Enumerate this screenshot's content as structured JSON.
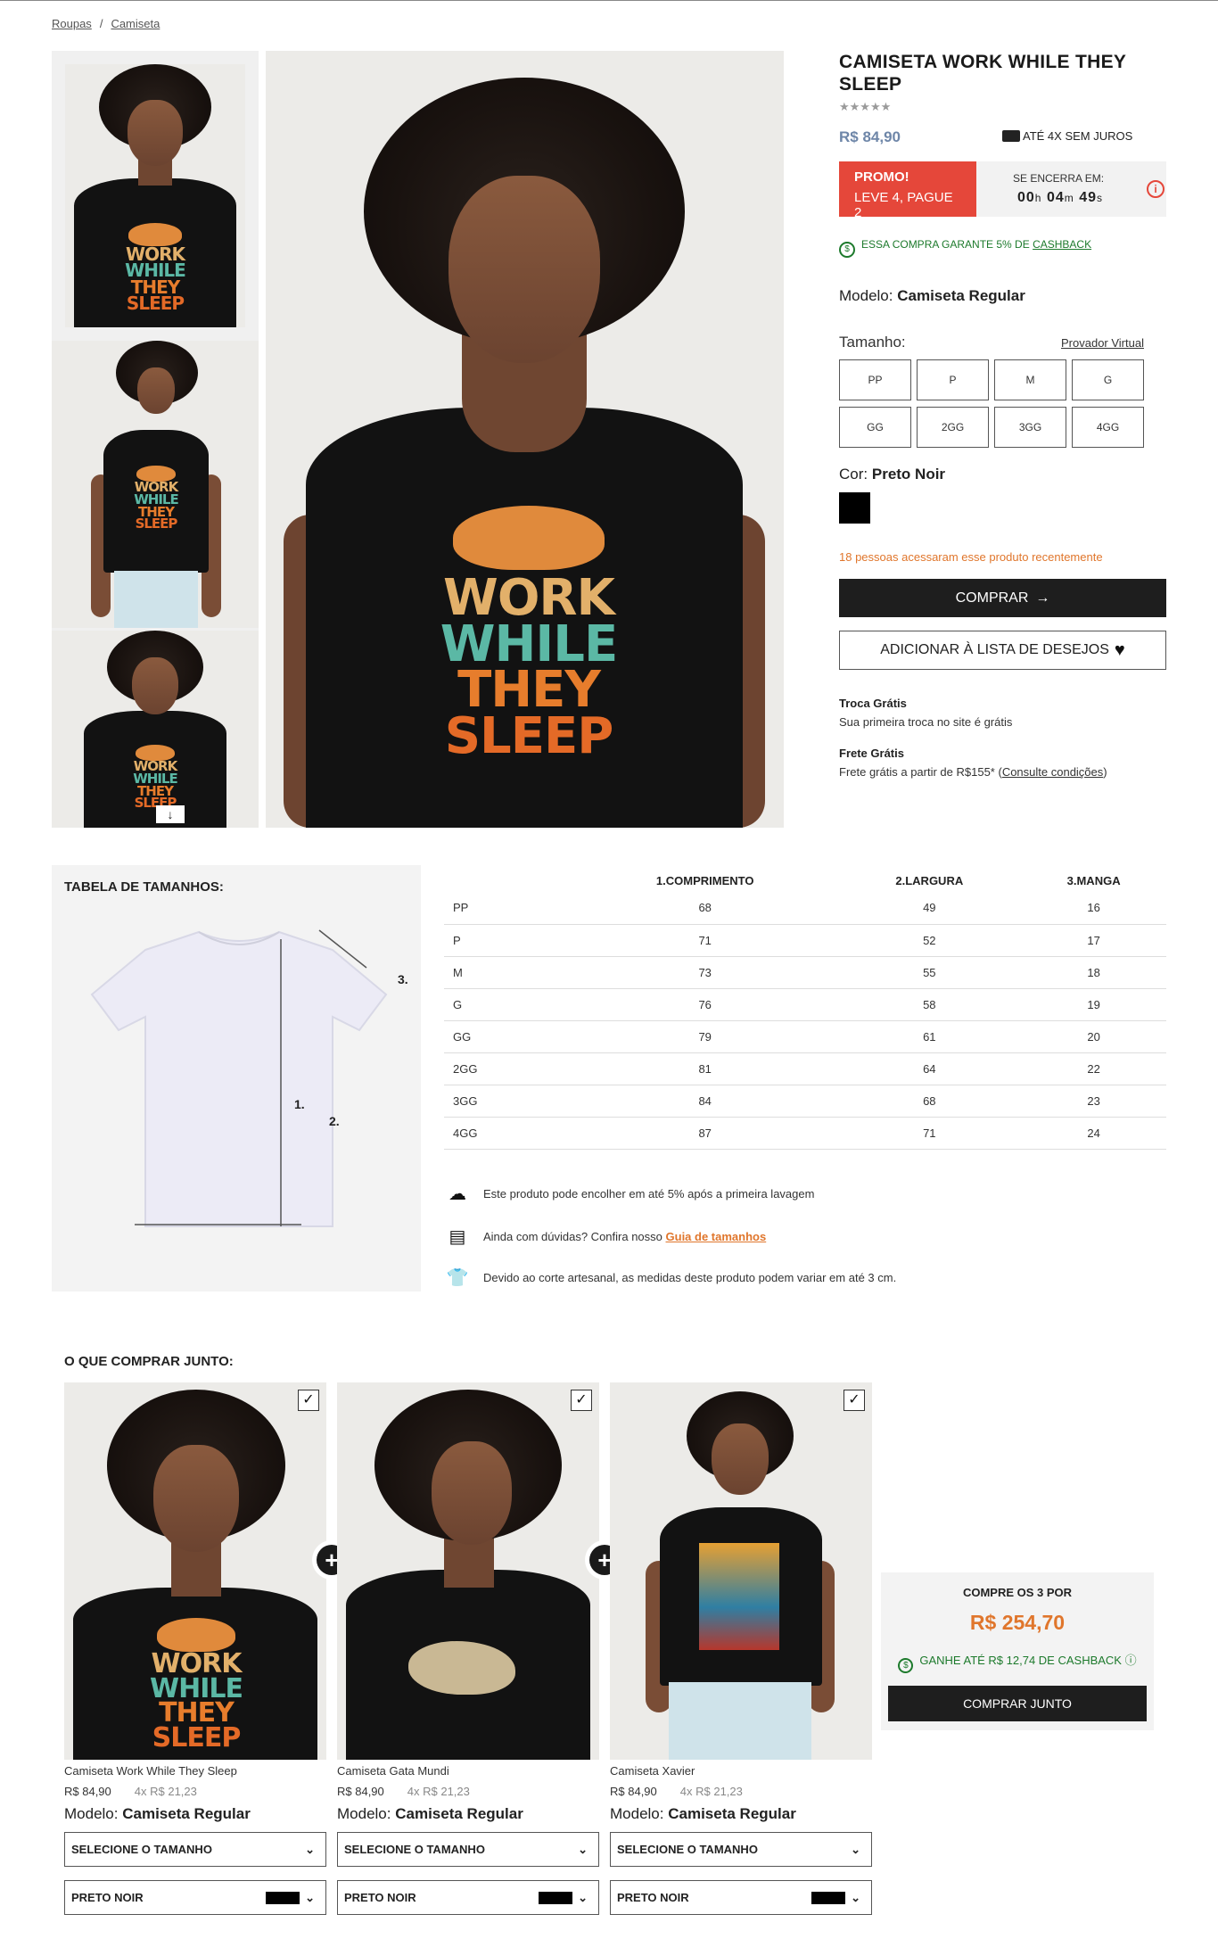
{
  "breadcrumb": {
    "item1": "Roupas",
    "item2": "Camiseta"
  },
  "product": {
    "title": "CAMISETA WORK WHILE THEY SLEEP",
    "stars": "★★★★★",
    "price": "R$ 84,90",
    "installments": "ATÉ 4X SEM JUROS",
    "print_lines": [
      "WORK",
      "WHILE",
      "THEY",
      "SLEEP"
    ],
    "promo": {
      "tag": "PROMO!",
      "offer": "LEVE 4, PAGUE 2",
      "ends_label": "SE ENCERRA EM:",
      "h": "00",
      "m": "04",
      "s": "49",
      "h_unit": "h",
      "m_unit": "m",
      "s_unit": "s"
    },
    "cashback_text": "ESSA COMPRA GARANTE 5% DE",
    "cashback_link": "CASHBACK",
    "modelo_label": "Modelo:",
    "modelo_value": "Camiseta Regular",
    "size_label": "Tamanho:",
    "virtual_fitter": "Provador Virtual",
    "sizes": [
      "PP",
      "P",
      "M",
      "G",
      "GG",
      "2GG",
      "3GG",
      "4GG"
    ],
    "color_label": "Cor:",
    "color_value": "Preto Noir",
    "color_hex": "#000000",
    "viewers": "18 pessoas acessaram esse produto recentemente",
    "buy_button": "COMPRAR",
    "wishlist_button": "ADICIONAR À LISTA DE DESEJOS",
    "benefit1_title": "Troca Grátis",
    "benefit1_desc": "Sua primeira troca no site é grátis",
    "benefit2_title": "Frete Grátis",
    "benefit2_desc": "Frete grátis a partir de R$155* (",
    "benefit2_link": "Consulte condições",
    "benefit2_end": ")"
  },
  "size_table": {
    "title": "TABELA DE TAMANHOS:",
    "diagram_labels": [
      "1.",
      "2.",
      "3."
    ],
    "headers": [
      "",
      "1.COMPRIMENTO",
      "2.LARGURA",
      "3.MANGA"
    ],
    "rows": [
      [
        "PP",
        "68",
        "49",
        "16"
      ],
      [
        "P",
        "71",
        "52",
        "17"
      ],
      [
        "M",
        "73",
        "55",
        "18"
      ],
      [
        "G",
        "76",
        "58",
        "19"
      ],
      [
        "GG",
        "79",
        "61",
        "20"
      ],
      [
        "2GG",
        "81",
        "64",
        "22"
      ],
      [
        "3GG",
        "84",
        "68",
        "23"
      ],
      [
        "4GG",
        "87",
        "71",
        "24"
      ]
    ],
    "note1": "Este produto pode encolher em até 5% após a primeira lavagem",
    "note2": "Ainda com dúvidas? Confira nosso",
    "note2_link": "Guia de tamanhos",
    "note3": "Devido ao corte artesanal, as medidas deste produto podem variar em até 3 cm."
  },
  "buy_together": {
    "title": "O QUE COMPRAR JUNTO:",
    "products": [
      {
        "name": "Camiseta Work While They Sleep",
        "price": "R$ 84,90",
        "installments": "4x R$ 21,23",
        "modelo_label": "Modelo:",
        "modelo_value": "Camiseta Regular",
        "size_select": "SELECIONE O TAMANHO",
        "color": "PRETO NOIR"
      },
      {
        "name": "Camiseta Gata Mundi",
        "price": "R$ 84,90",
        "installments": "4x R$ 21,23",
        "modelo_label": "Modelo:",
        "modelo_value": "Camiseta Regular",
        "size_select": "SELECIONE O TAMANHO",
        "color": "PRETO NOIR"
      },
      {
        "name": "Camiseta Xavier",
        "price": "R$ 84,90",
        "installments": "4x R$ 21,23",
        "modelo_label": "Modelo:",
        "modelo_value": "Camiseta Regular",
        "size_select": "SELECIONE O TAMANHO",
        "color": "PRETO NOIR"
      }
    ],
    "combo_label": "COMPRE OS 3 POR",
    "combo_price": "R$ 254,70",
    "combo_cashback": "GANHE ATÉ R$ 12,74 DE CASHBACK",
    "combo_button": "COMPRAR JUNTO"
  },
  "colors": {
    "accent_orange": "#e0762c",
    "promo_red": "#e5473a",
    "cashback_green": "#1d7a2c",
    "button_dark": "#1e1e1e",
    "price_blue": "#6e86a8"
  }
}
